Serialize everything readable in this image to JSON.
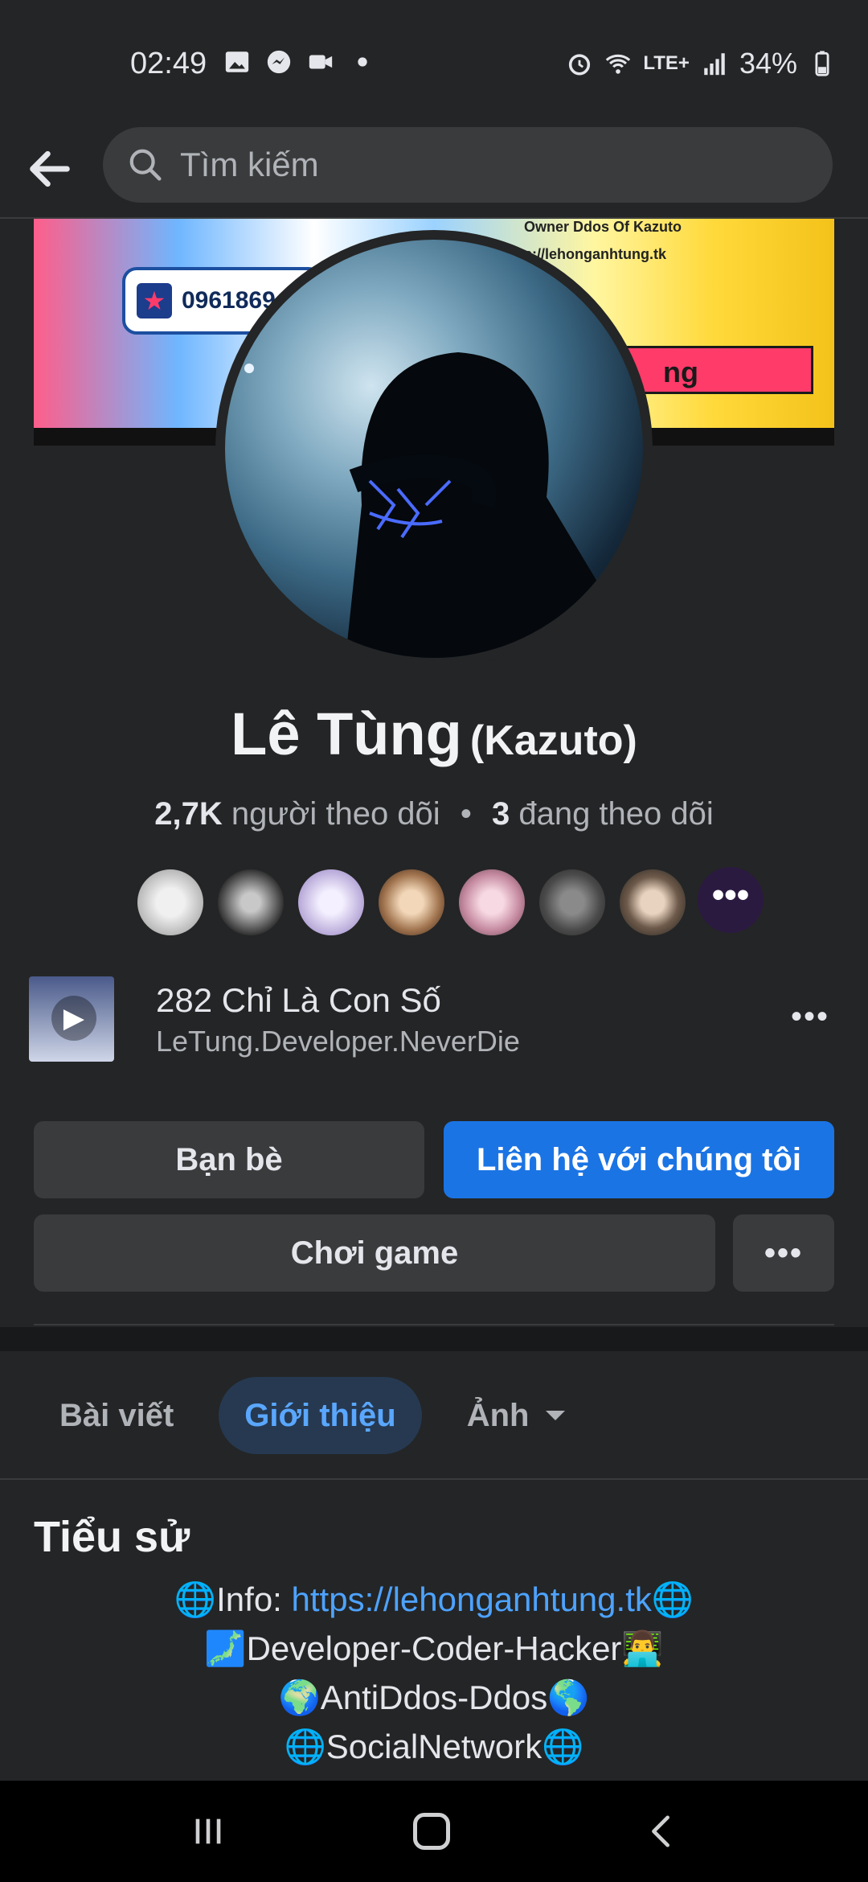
{
  "status_bar": {
    "time": "02:49",
    "battery": "34%",
    "network": "LTE+"
  },
  "header": {
    "search_placeholder": "Tìm kiếm"
  },
  "cover": {
    "phone": "0961869",
    "owner_text": "Owner Ddos Of Kazuto",
    "link_text": "s://lehonganhtung.tk",
    "banner_text": "ng"
  },
  "profile": {
    "name": "Lê Tùng",
    "alt_name": "(Kazuto)",
    "followers_count": "2,7K",
    "followers_label": "người theo dõi",
    "following_count": "3",
    "following_label": "đang theo dõi"
  },
  "music": {
    "title": "282 Chỉ Là Con Số",
    "subtitle": "LeTung.Developer.NeverDie"
  },
  "buttons": {
    "friends": "Bạn bè",
    "contact": "Liên hệ với chúng tôi",
    "game": "Chơi game",
    "more": "•••"
  },
  "tabs": {
    "posts": "Bài viết",
    "about": "Giới thiệu",
    "photos": "Ảnh"
  },
  "bio": {
    "title": "Tiểu sử",
    "line1_prefix": "🌐Info: ",
    "line1_link": "https://lehonganhtung.tk",
    "line1_suffix": "🌐",
    "line2": "🗾Developer-Coder-Hacker👨‍💻",
    "line3": "🌍AntiDdos-Ddos🌎",
    "line4": "🌐SocialNetwork🌐"
  },
  "colors": {
    "background": "#242526",
    "accent_blue": "#1b74e4",
    "link_blue": "#4da3ff"
  }
}
